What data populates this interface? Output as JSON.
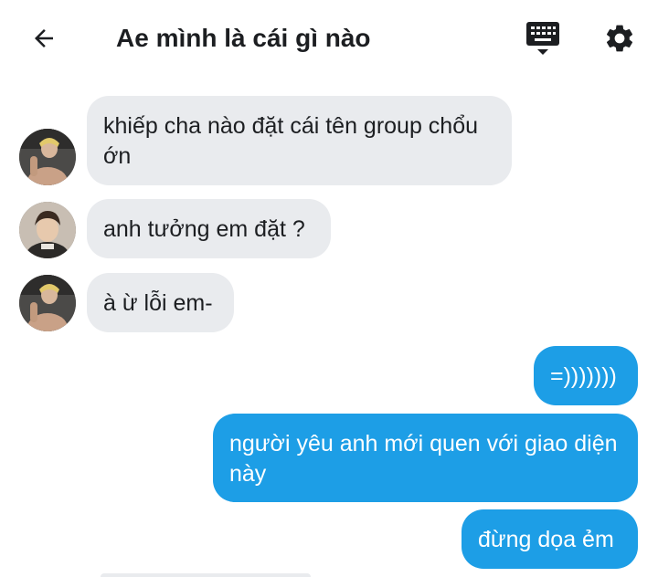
{
  "header": {
    "title": "Ae mình là cái gì nào",
    "icons": {
      "back": "arrow-back-icon",
      "keyboard": "keyboard-icon",
      "settings": "gear-icon"
    }
  },
  "messages": [
    {
      "direction": "incoming",
      "text": "khiếp cha nào đặt cái tên group chổu ớn",
      "avatar": "avatar-user-1"
    },
    {
      "direction": "incoming",
      "text": "anh tưởng em đặt ?",
      "avatar": "avatar-user-2"
    },
    {
      "direction": "incoming",
      "text": "à ừ lỗi em-",
      "avatar": "avatar-user-1"
    },
    {
      "direction": "outgoing",
      "text": "=)))))))"
    },
    {
      "direction": "outgoing",
      "text": "người yêu anh mới quen với giao diện này"
    },
    {
      "direction": "outgoing",
      "text": "đừng dọa ẻm"
    }
  ],
  "colors": {
    "incoming_bubble": "#e9ebee",
    "outgoing_bubble": "#1d9ee6",
    "text_dark": "#1c1e21"
  }
}
